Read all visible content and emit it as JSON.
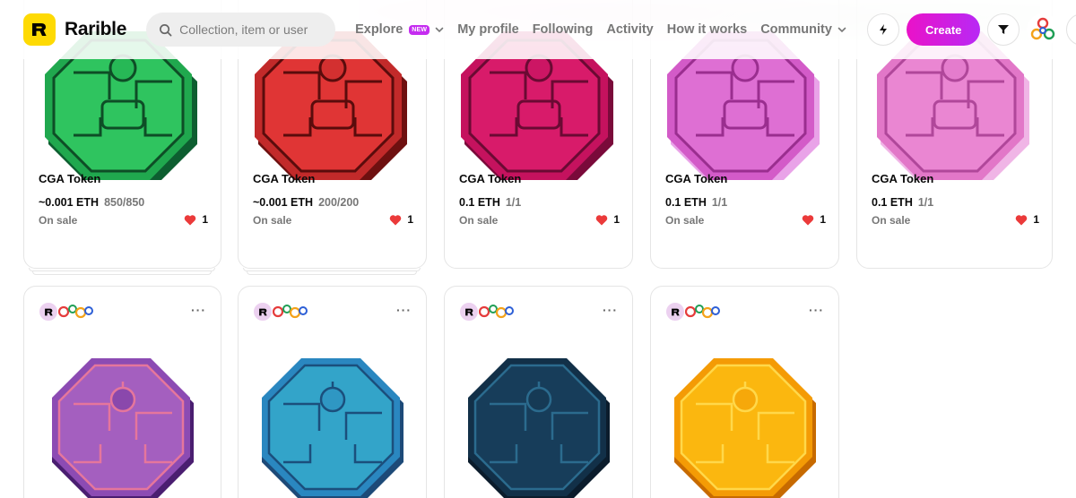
{
  "header": {
    "brand": "Rarible",
    "search_placeholder": "Collection, item or user",
    "nav": {
      "explore": "Explore",
      "explore_badge": "NEW",
      "my_profile": "My profile",
      "following": "Following",
      "activity": "Activity",
      "how_it_works": "How it works",
      "community": "Community"
    },
    "create_label": "Create",
    "icons": [
      "lightning-icon",
      "filter-icon",
      "avatar",
      "moon-icon"
    ]
  },
  "colors": {
    "brand_yellow": "#feda03",
    "create_gradient_start": "#ea12c8",
    "create_gradient_end": "#b829f5",
    "heart": "#eb3a3a"
  },
  "row1": [
    {
      "title": "CGA Token",
      "price": "~0.001 ETH",
      "qty": "850/850",
      "status": "On sale",
      "likes": "1",
      "token_color": "green"
    },
    {
      "title": "CGA Token",
      "price": "~0.001 ETH",
      "qty": "200/200",
      "status": "On sale",
      "likes": "1",
      "token_color": "red"
    },
    {
      "title": "CGA Token",
      "price": "0.1 ETH",
      "qty": "1/1",
      "status": "On sale",
      "likes": "1",
      "token_color": "crimson"
    },
    {
      "title": "CGA Token",
      "price": "0.1 ETH",
      "qty": "1/1",
      "status": "On sale",
      "likes": "1",
      "token_color": "pink"
    },
    {
      "title": "CGA Token",
      "price": "0.1 ETH",
      "qty": "1/1",
      "status": "On sale",
      "likes": "1",
      "token_color": "light-pink"
    }
  ],
  "row2": [
    {
      "token_color": "purple",
      "more": "···"
    },
    {
      "token_color": "teal",
      "more": "···"
    },
    {
      "token_color": "navy",
      "more": "···"
    },
    {
      "token_color": "gold",
      "more": "···"
    }
  ]
}
